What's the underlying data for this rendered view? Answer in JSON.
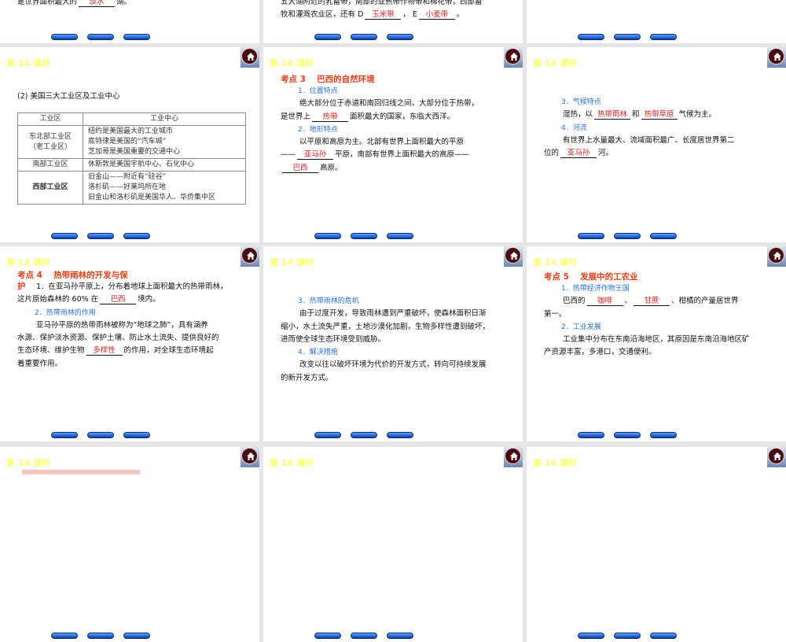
{
  "lesson_title": "第 14 课时",
  "colors": {
    "lesson": "#ffff66",
    "heading": "#e8401c",
    "subhead": "#2a6fd6",
    "answer": "#e02020"
  },
  "slides": [
    {
      "id": "top-left",
      "lines": [
        {
          "k": "p",
          "seg": [
            "是世界面积最大的",
            {
              "ans": "淡水"
            },
            "湖。"
          ]
        }
      ]
    },
    {
      "id": "top-mid",
      "lines": [
        {
          "k": "p",
          "seg": [
            "五大湖附近的乳畜带，南部的亚热带作物带和棉花带，西部畜"
          ]
        },
        {
          "k": "p",
          "seg": [
            "牧和灌溉农业区，还有 D",
            {
              "ans": "玉米带"
            },
            "， E",
            {
              "ans": "小麦带"
            },
            "。"
          ]
        }
      ]
    },
    {
      "id": "top-right",
      "lines": []
    },
    {
      "id": "us-industry",
      "lines": [
        {
          "k": "p",
          "seg": [
            "(2) 美国三大工业区及工业中心"
          ]
        }
      ],
      "table": {
        "headers": [
          "工业区",
          "工业中心"
        ],
        "rows": [
          {
            "region": "东北部工业区（老工业区）",
            "centers": [
              "纽约是美国最大的工业城市",
              "底特律是美国的“汽车城”",
              "芝加哥是美国重要的交通中心"
            ]
          },
          {
            "region": "南部工业区",
            "centers": [
              "休斯敦是美国宇航中心、石化中心"
            ]
          },
          {
            "region": "西部工业区",
            "centers": [
              "旧金山——附近有“硅谷”",
              "洛杉矶——好莱坞所在地",
              "旧金山和洛杉矶是美国华人、华侨集中区"
            ]
          }
        ]
      }
    },
    {
      "id": "brazil-nature",
      "lines": [
        {
          "k": "h",
          "seg": [
            "考点 3　 巴西的自然环境"
          ]
        },
        {
          "k": "s",
          "seg": [
            "1．位置特点"
          ]
        },
        {
          "k": "p1",
          "seg": [
            "绝大部分位于赤道和南回归线之间，大部分位于热带，"
          ]
        },
        {
          "k": "p",
          "seg": [
            "是世界上",
            {
              "ans": "热带"
            },
            "面积最大的国家，东临大西洋。"
          ]
        },
        {
          "k": "s",
          "seg": [
            "2．地形特点"
          ]
        },
        {
          "k": "p1",
          "seg": [
            "以平原和高原为主。北部有世界上面积最大的平原"
          ]
        },
        {
          "k": "p",
          "seg": [
            "——",
            {
              "ans": "亚马孙"
            },
            "平原，南部有世界上面积最大的高原——"
          ]
        },
        {
          "k": "p",
          "seg": [
            {
              "ans": "巴西"
            },
            "高原。"
          ]
        }
      ]
    },
    {
      "id": "climate-river",
      "lines": [
        {
          "k": "s",
          "seg": [
            "3．气候特点"
          ]
        },
        {
          "k": "p1",
          "seg": [
            "湿热，以",
            {
              "ans": "热带雨林"
            },
            "和",
            {
              "ans": "热带草原"
            },
            "气候为主。"
          ]
        },
        {
          "k": "s",
          "seg": [
            "4．河流"
          ]
        },
        {
          "k": "p1",
          "seg": [
            "有世界上水量最大、流域面积最广、长度居世界第二"
          ]
        },
        {
          "k": "p",
          "seg": [
            "位的",
            {
              "ans": "亚马孙"
            },
            "河。"
          ]
        }
      ]
    },
    {
      "id": "rainforest",
      "lines": [
        {
          "k": "h",
          "seg": [
            "考点 4　 热带雨林的开发与保护"
          ]
        },
        {
          "k": "p1",
          "seg": [
            "1．在亚马孙平原上，分布着地球上面积最大的热带雨林，"
          ]
        },
        {
          "k": "p",
          "seg": [
            "这片原始森林的 60% 在",
            {
              "ans": "巴西"
            },
            "境内。"
          ]
        },
        {
          "k": "s",
          "seg": [
            "2．热带雨林的作用"
          ]
        },
        {
          "k": "p1",
          "seg": [
            "亚马孙平原的热带雨林被称为“地球之肺”，具有涵养"
          ]
        },
        {
          "k": "p",
          "seg": [
            "水源、保护淡水资源、保护土壤、防止水土流失、提供良好的"
          ]
        },
        {
          "k": "p",
          "seg": [
            "生态环境、维护生物",
            {
              "ans": "多样性"
            },
            "的作用，对全球生态环境起"
          ]
        },
        {
          "k": "p",
          "seg": [
            "着重要作用。"
          ]
        }
      ]
    },
    {
      "id": "rainforest-crisis",
      "lines": [
        {
          "k": "s",
          "seg": [
            "3．热带雨林的危机"
          ]
        },
        {
          "k": "p1",
          "seg": [
            "由于过度开发，导致雨林遭到严重破坏，使森林面积日渐"
          ]
        },
        {
          "k": "p",
          "seg": [
            "缩小，水土流失严重，土地沙漠化加剧，生物多样性遭到破坏，"
          ]
        },
        {
          "k": "p",
          "seg": [
            "进而使全球生态环境受到威胁。"
          ]
        },
        {
          "k": "s",
          "seg": [
            "4．解决措施"
          ]
        },
        {
          "k": "p1",
          "seg": [
            "改变以往以破坏环境为代价的开发方式，转向可持续发展"
          ]
        },
        {
          "k": "p",
          "seg": [
            "的新开发方式。"
          ]
        }
      ]
    },
    {
      "id": "agri-industry",
      "lines": [
        {
          "k": "h",
          "seg": [
            "考点 5　 发展中的工农业"
          ]
        },
        {
          "k": "s",
          "seg": [
            "1．热带经济作物王国"
          ]
        },
        {
          "k": "p1",
          "seg": [
            "巴西的",
            {
              "ans": "咖啡"
            },
            "、",
            {
              "ans": "甘蔗"
            },
            "、柑橘的产量居世界"
          ]
        },
        {
          "k": "p",
          "seg": [
            "第一。"
          ]
        },
        {
          "k": "s",
          "seg": [
            "2．工业发展"
          ]
        },
        {
          "k": "p1",
          "seg": [
            "工业集中分布在东南沿海地区，其原因是东南沿海地区矿"
          ]
        },
        {
          "k": "p",
          "seg": [
            "产资源丰富，多港口，交通便利。"
          ]
        }
      ]
    },
    {
      "id": "bottom-left",
      "lines": []
    },
    {
      "id": "bottom-mid",
      "lines": []
    },
    {
      "id": "bottom-right",
      "lines": []
    }
  ]
}
